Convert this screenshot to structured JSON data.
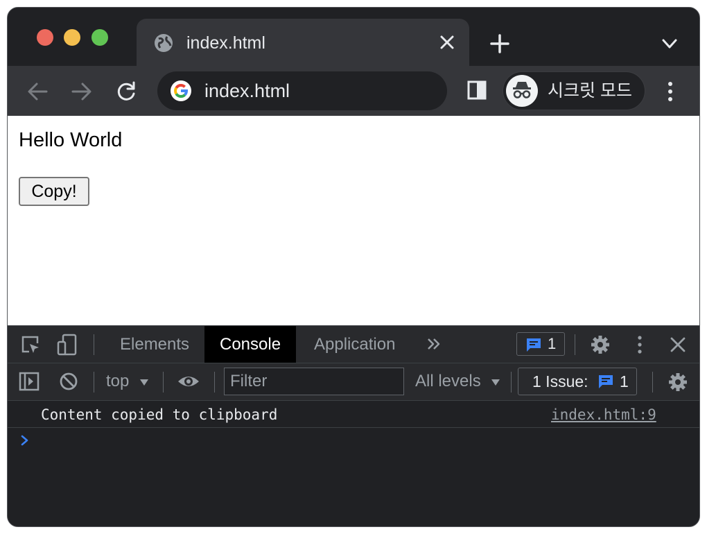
{
  "browser": {
    "tab": {
      "title": "index.html"
    },
    "omnibox": {
      "url": "index.html"
    },
    "profile": {
      "label": "시크릿 모드"
    }
  },
  "page": {
    "heading": "Hello World",
    "copy_button_label": "Copy!"
  },
  "devtools": {
    "tabs": [
      {
        "label": "Elements"
      },
      {
        "label": "Console"
      },
      {
        "label": "Application"
      }
    ],
    "messages_badge_count": "1",
    "context": "top",
    "filter_placeholder": "Filter",
    "levels": "All levels",
    "issues_label": "1 Issue:",
    "issues_count": "1",
    "console": {
      "message": "Content copied to clipboard",
      "source": "index.html:9"
    }
  },
  "colors": {
    "window_bg": "#202124",
    "toolbar_bg": "#35363a",
    "accent_blue": "#3b82f6",
    "traffic_red": "#ed6a5e",
    "traffic_yellow": "#f4bf4f",
    "traffic_green": "#61c554"
  },
  "icons": [
    "globe-icon",
    "close-icon",
    "plus-icon",
    "chevron-down-icon",
    "back-arrow-icon",
    "forward-arrow-icon",
    "reload-icon",
    "google-logo",
    "side-panel-icon",
    "incognito-icon",
    "more-vert-icon",
    "inspect-icon",
    "device-toggle-icon",
    "more-tabs-icon",
    "message-icon",
    "gear-icon",
    "sidebar-toggle-icon",
    "clear-icon",
    "eye-icon",
    "prompt-chevron-icon"
  ]
}
